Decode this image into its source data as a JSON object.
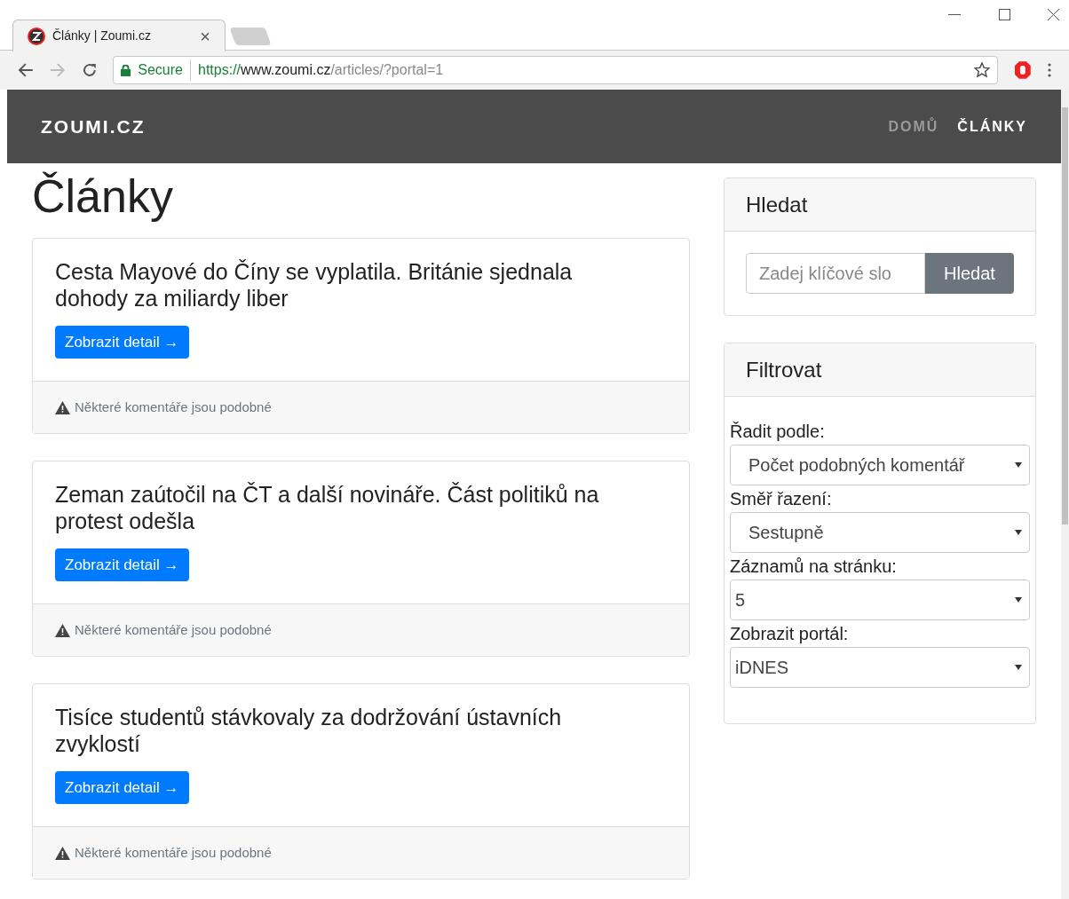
{
  "browser": {
    "tab": {
      "title": "Články | Zoumi.cz",
      "close": "×"
    },
    "address": {
      "secure": "Secure",
      "scheme": "https://",
      "host": "www.zoumi.cz",
      "path": "/articles/?portal=1"
    }
  },
  "navbar": {
    "brand": "ZOUMI.CZ",
    "items": [
      {
        "label": "DOMŮ",
        "selected": false
      },
      {
        "label": "ČLÁNKY",
        "selected": true
      }
    ]
  },
  "heading": "Články",
  "articles": [
    {
      "title": "Cesta Mayové do Číny se vyplatila. Británie sjednala dohody za miliardy liber",
      "button": "Zobrazit detail →",
      "warning": "Některé komentáře jsou podobné"
    },
    {
      "title": "Zeman zaútočil na ČT a další novináře. Část politiků na protest odešla",
      "button": "Zobrazit detail →",
      "warning": "Některé komentáře jsou podobné"
    },
    {
      "title": "Tisíce studentů stávkovaly za dodržování ústavních zvyklostí",
      "button": "Zobrazit detail →",
      "warning": "Některé komentáře jsou podobné"
    }
  ],
  "search": {
    "title": "Hledat",
    "placeholder": "Zadej klíčové slo",
    "button": "Hledat"
  },
  "filter": {
    "title": "Filtrovat",
    "fields": [
      {
        "label": "Řadit podle:",
        "value": "Počet podobných komentář",
        "indented": true
      },
      {
        "label": "Směř řazení:",
        "value": "Sestupně",
        "indented": true
      },
      {
        "label": "Záznamů na stránku:",
        "value": "5",
        "indented": false
      },
      {
        "label": "Zobrazit portál:",
        "value": "iDNES",
        "indented": false
      }
    ]
  }
}
